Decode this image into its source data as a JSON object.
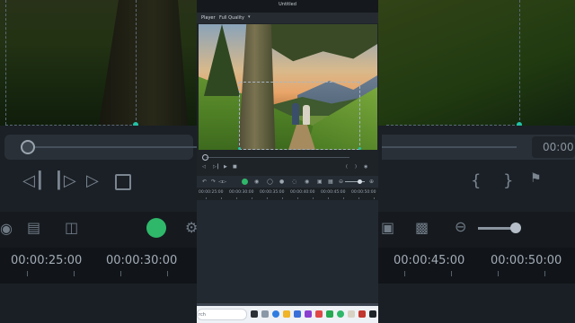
{
  "app": {
    "window_title": "Untitled"
  },
  "player": {
    "tab_label": "Player",
    "quality_label": "Full Quality",
    "playhead_progress": 0.0
  },
  "timeline": {
    "small_ruler_labels": [
      "00:00:25:00",
      "00:00:30:00",
      "00:00:35:00",
      "00:00:40:00",
      "00:00:45:00",
      "00:00:50:00"
    ],
    "large_ruler_labels": [
      "00:00:25:00",
      "00:00:30:00",
      "00:00:45:00",
      "00:00:50:00"
    ],
    "zoom_level": 0.75
  },
  "background": {
    "timecode_fragment": "00:00",
    "brace_open": "{",
    "brace_close": "}"
  },
  "taskbar": {
    "search_text": "rch"
  },
  "colors": {
    "accent": "#23c3a8",
    "green_button": "#2fb86a",
    "panel": "#1e2328",
    "taskbar": "#eef1f5"
  },
  "icons": [
    "play-icon",
    "stop-icon",
    "step-forward-icon",
    "chevron-down-icon",
    "undo-icon",
    "redo-icon",
    "split-icon",
    "ai-mask-icon",
    "zoom-out-icon",
    "zoom-in-icon",
    "search-icon"
  ]
}
